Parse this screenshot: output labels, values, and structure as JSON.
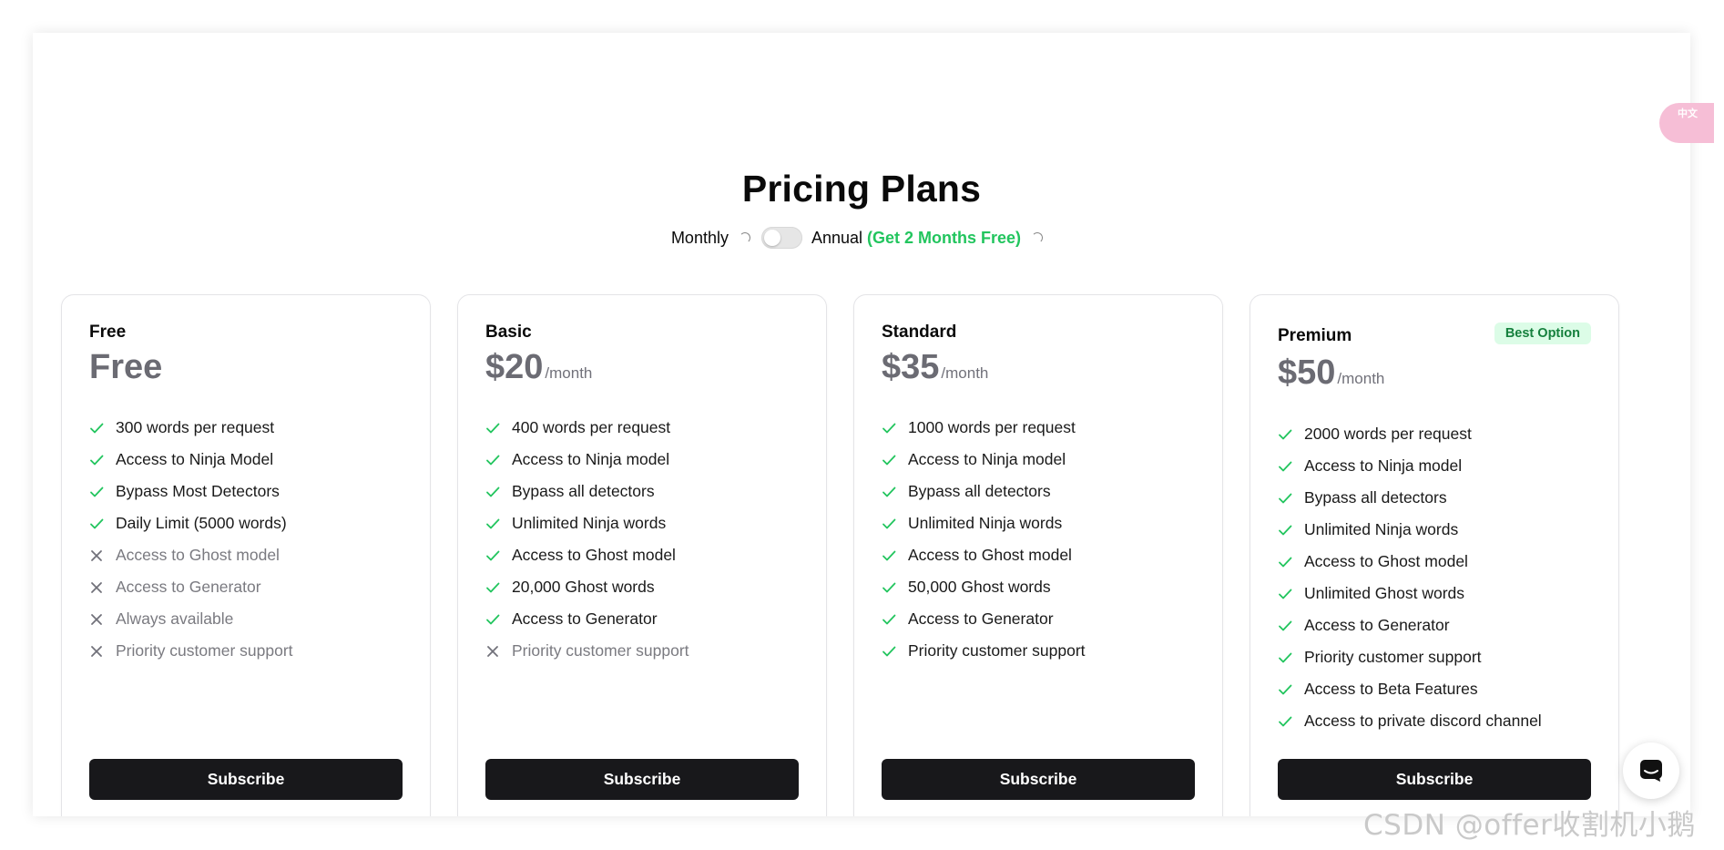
{
  "header": {
    "title": "Pricing Plans",
    "monthly_label": "Monthly",
    "annual_label": "Annual",
    "annual_note": "(Get 2 Months Free)"
  },
  "plans": [
    {
      "name": "Free",
      "price": "Free",
      "period": "",
      "badge": "",
      "features": [
        {
          "text": "300 words per request",
          "included": true
        },
        {
          "text": "Access to Ninja Model",
          "included": true
        },
        {
          "text": "Bypass Most Detectors",
          "included": true
        },
        {
          "text": "Daily Limit (5000 words)",
          "included": true
        },
        {
          "text": "Access to Ghost model",
          "included": false
        },
        {
          "text": "Access to Generator",
          "included": false
        },
        {
          "text": "Always available",
          "included": false
        },
        {
          "text": "Priority customer support",
          "included": false
        }
      ],
      "button": "Subscribe"
    },
    {
      "name": "Basic",
      "price": "$20",
      "period": "/month",
      "badge": "",
      "features": [
        {
          "text": "400 words per request",
          "included": true
        },
        {
          "text": "Access to Ninja model",
          "included": true
        },
        {
          "text": "Bypass all detectors",
          "included": true
        },
        {
          "text": "Unlimited Ninja words",
          "included": true
        },
        {
          "text": "Access to Ghost model",
          "included": true
        },
        {
          "text": "20,000 Ghost words",
          "included": true
        },
        {
          "text": "Access to Generator",
          "included": true
        },
        {
          "text": "Priority customer support",
          "included": false
        }
      ],
      "button": "Subscribe"
    },
    {
      "name": "Standard",
      "price": "$35",
      "period": "/month",
      "badge": "",
      "features": [
        {
          "text": "1000 words per request",
          "included": true
        },
        {
          "text": "Access to Ninja model",
          "included": true
        },
        {
          "text": "Bypass all detectors",
          "included": true
        },
        {
          "text": "Unlimited Ninja words",
          "included": true
        },
        {
          "text": "Access to Ghost model",
          "included": true
        },
        {
          "text": "50,000 Ghost words",
          "included": true
        },
        {
          "text": "Access to Generator",
          "included": true
        },
        {
          "text": "Priority customer support",
          "included": true
        }
      ],
      "button": "Subscribe"
    },
    {
      "name": "Premium",
      "price": "$50",
      "period": "/month",
      "badge": "Best Option",
      "features": [
        {
          "text": "2000 words per request",
          "included": true
        },
        {
          "text": "Access to Ninja model",
          "included": true
        },
        {
          "text": "Bypass all detectors",
          "included": true
        },
        {
          "text": "Unlimited Ninja words",
          "included": true
        },
        {
          "text": "Access to Ghost model",
          "included": true
        },
        {
          "text": "Unlimited Ghost words",
          "included": true
        },
        {
          "text": "Access to Generator",
          "included": true
        },
        {
          "text": "Priority customer support",
          "included": true
        },
        {
          "text": "Access to Beta Features",
          "included": true
        },
        {
          "text": "Access to private discord channel",
          "included": true
        }
      ],
      "button": "Subscribe"
    }
  ],
  "side_tab": {
    "label": "中文",
    "icon": "translate-icon"
  },
  "chat_button": {
    "icon": "chat-icon"
  },
  "watermark": "CSDN @offer收割机小鹅",
  "colors": {
    "check": "#22c55e",
    "cross": "#71717a",
    "accent": "#22c55e",
    "button": "#18181b"
  }
}
